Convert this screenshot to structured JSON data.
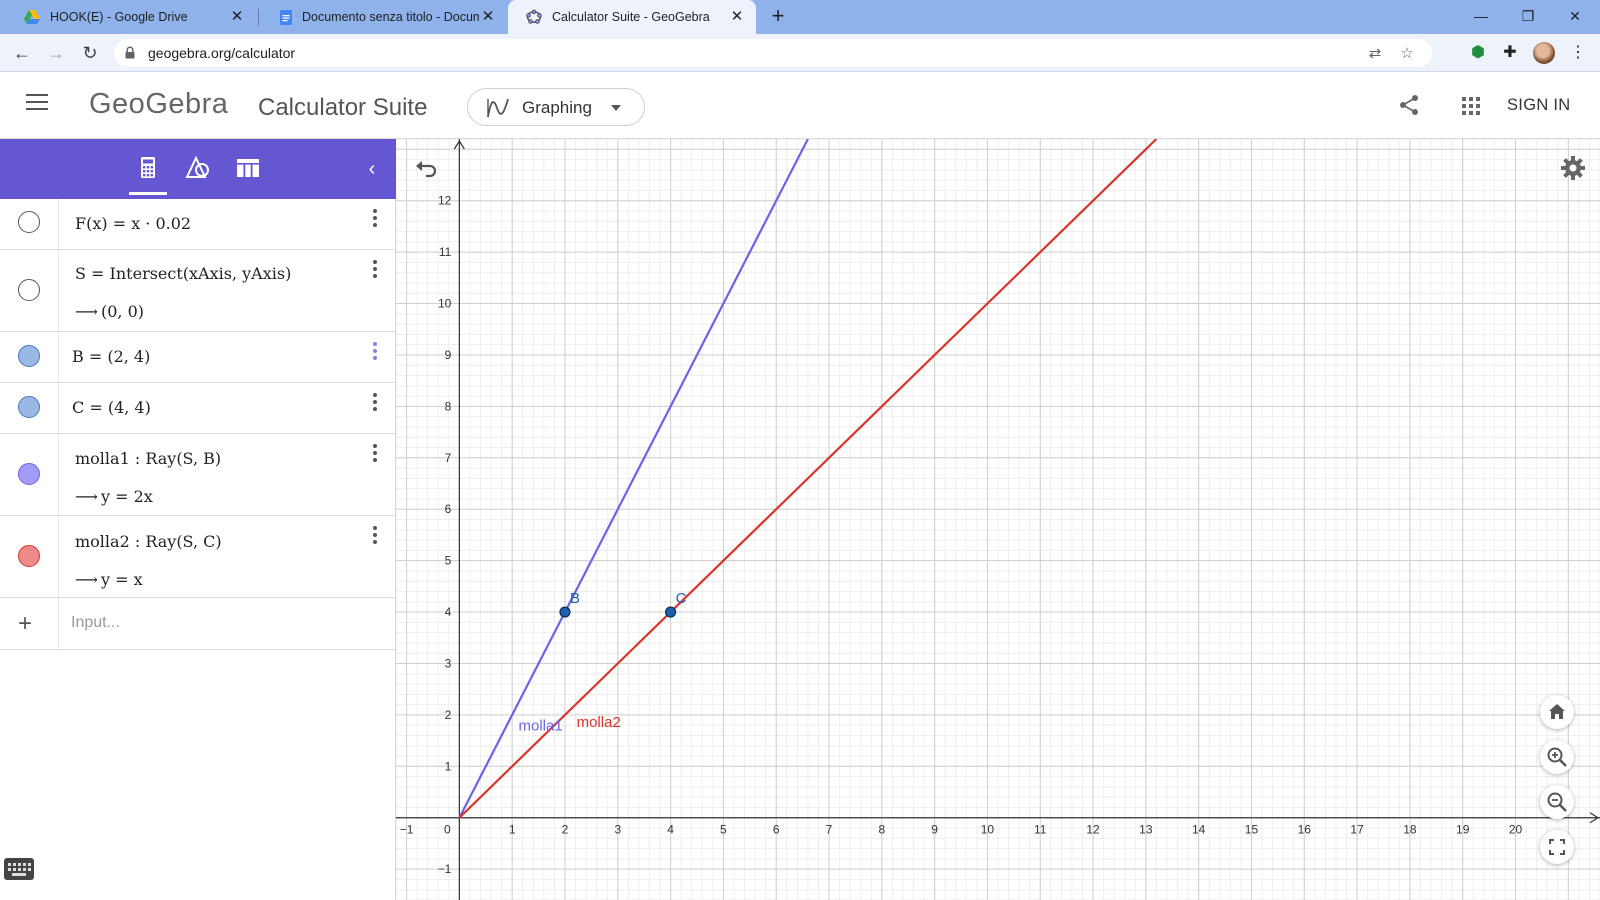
{
  "browser": {
    "tabs": [
      {
        "title": "HOOK(E) - Google Drive",
        "icon": "google-drive-icon",
        "active": false
      },
      {
        "title": "Documento senza titolo - Docum",
        "icon": "google-docs-icon",
        "active": false
      },
      {
        "title": "Calculator Suite - GeoGebra",
        "icon": "geogebra-icon",
        "active": true
      }
    ],
    "url": "geogebra.org/calculator"
  },
  "header": {
    "logo": "GeoGebra",
    "suite": "Calculator Suite",
    "app_picker": "Graphing",
    "sign_in": "SIGN IN"
  },
  "algebra": {
    "rows": [
      {
        "definition": "F(x)  =  x · 0.02",
        "output": "",
        "marble": "off"
      },
      {
        "definition": "S  =  Intersect(xAxis, yAxis)",
        "output": "(0, 0)",
        "marble": "off"
      },
      {
        "definition": "B  =  (2, 4)",
        "output": "",
        "marble": "on",
        "color": "#9ab8e6"
      },
      {
        "definition": "C  =  (4, 4)",
        "output": "",
        "marble": "on",
        "color": "#9ab8e6"
      },
      {
        "definition": "molla1 : Ray(S, B)",
        "output": "y  =  2x",
        "marble": "on",
        "color": "#a39cf6"
      },
      {
        "definition": "molla2 : Ray(S, C)",
        "output": "y  =  x",
        "marble": "on",
        "color": "#ee8a8a"
      }
    ],
    "input_placeholder": "Input..."
  },
  "graph": {
    "x_ticks": [
      "−1",
      "0",
      "1",
      "2",
      "3",
      "4",
      "5",
      "6",
      "7",
      "8",
      "9",
      "10",
      "11",
      "12",
      "13",
      "14",
      "15",
      "16",
      "17",
      "18",
      "19",
      "20"
    ],
    "y_ticks": [
      "−1",
      "1",
      "2",
      "3",
      "4",
      "5",
      "6",
      "7",
      "8",
      "9",
      "10",
      "11",
      "12"
    ],
    "x_range": [
      -1.2,
      21.6
    ],
    "y_range": [
      -1.6,
      13.2
    ],
    "points": [
      {
        "name": "B",
        "x": 2,
        "y": 4,
        "color": "#1f5fae"
      },
      {
        "name": "C",
        "x": 4,
        "y": 4,
        "color": "#1f5fae"
      }
    ],
    "rays": [
      {
        "name": "molla1",
        "slope": 2,
        "color": "#6b63e8"
      },
      {
        "name": "molla2",
        "slope": 1,
        "color": "#d9342b"
      }
    ],
    "ray_labels": [
      {
        "text": "molla1",
        "color": "#6b63e8"
      },
      {
        "text": "molla2",
        "color": "#d9342b"
      }
    ]
  }
}
